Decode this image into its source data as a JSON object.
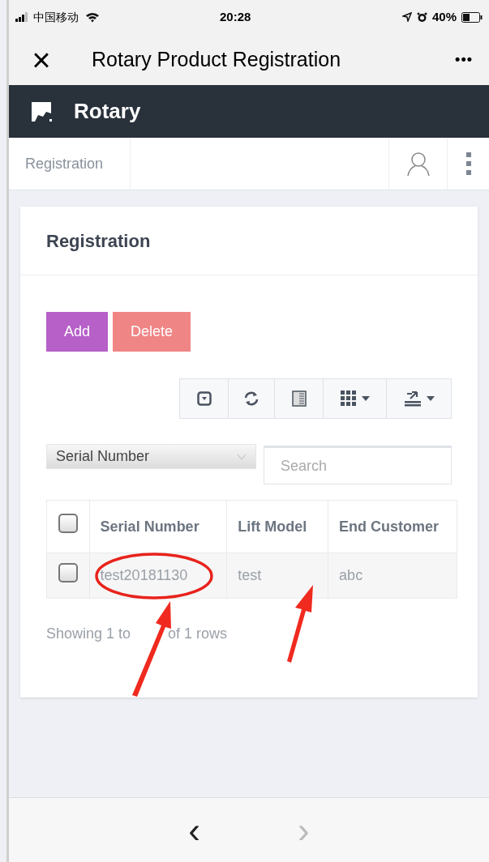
{
  "status_bar": {
    "carrier": "中国移动",
    "time": "20:28",
    "battery": "40%"
  },
  "nav_bar": {
    "close": "×",
    "title": "Rotary Product Registration",
    "more": "•••"
  },
  "app_header": {
    "title": "Rotary"
  },
  "sub_bar": {
    "tab": "Registration"
  },
  "card": {
    "title": "Registration",
    "buttons": [
      {
        "label": "Add",
        "color": "#b660c8"
      },
      {
        "label": "Delete",
        "color": "#f08585"
      }
    ],
    "search_column": "Serial Number",
    "search": {
      "placeholder": "Search"
    },
    "table": {
      "columns": [
        "Serial Number",
        "Lift Model",
        "End Customer"
      ],
      "header_checked": false,
      "rows": [
        {
          "checked": false,
          "cells": [
            "test20181130",
            "test",
            "abc"
          ]
        }
      ]
    },
    "footer": [
      "Showing 1 to",
      "of 1 rows"
    ]
  },
  "bottom_bar": {
    "back": "‹",
    "forward": "›"
  }
}
